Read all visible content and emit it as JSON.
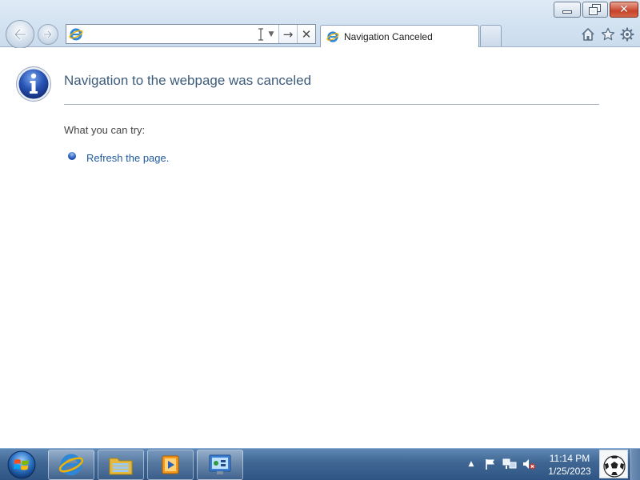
{
  "window": {
    "tab_title": "Navigation Canceled",
    "address_value": "",
    "controls": {
      "minimize": "minimize-icon",
      "maximize": "restore-icon",
      "close": "close-icon",
      "close_glyph": "✕"
    }
  },
  "navbar": {
    "back_icon": "back-arrow-icon",
    "forward_icon": "forward-arrow-icon",
    "go_glyph": "→",
    "stop_glyph": "✕",
    "dropdown_glyph": "▼",
    "tools": [
      "home-icon",
      "favorites-star-icon",
      "tools-gear-icon"
    ]
  },
  "page": {
    "heading": "Navigation to the webpage was canceled",
    "try_label": "What you can try:",
    "suggestions": [
      {
        "label": "Refresh the page."
      }
    ]
  },
  "taskbar": {
    "pinned": [
      "internet-explorer-icon",
      "windows-explorer-icon",
      "media-player-icon",
      "control-panel-icon"
    ],
    "tray": [
      "show-hidden-icons",
      "action-center-flag-icon",
      "network-icon",
      "volume-muted-icon"
    ],
    "tray_arrow": "▲",
    "time": "11:14 PM",
    "date": "1/25/2023"
  },
  "colors": {
    "heading": "#3d5b7a",
    "link": "#1f5a9e",
    "taskbar": "#3f6693",
    "close_button": "#c7432a"
  }
}
